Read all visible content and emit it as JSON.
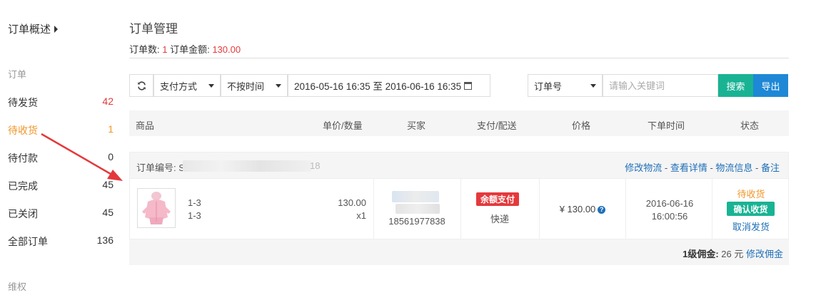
{
  "sidebar": {
    "overview": "订单概述",
    "section_orders": "订单",
    "section_rights": "维权",
    "items": [
      {
        "label": "待发货",
        "count": "42"
      },
      {
        "label": "待收货",
        "count": "1"
      },
      {
        "label": "待付款",
        "count": "0"
      },
      {
        "label": "已完成",
        "count": "45"
      },
      {
        "label": "已关闭",
        "count": "45"
      },
      {
        "label": "全部订单",
        "count": "136"
      }
    ]
  },
  "header": {
    "title": "订单管理",
    "order_count_label": "订单数: ",
    "order_count": "1",
    "order_amount_label": " 订单金额: ",
    "order_amount": "130.00"
  },
  "filters": {
    "payment_method": "支付方式",
    "time_mode": "不按时间",
    "date_range": "2016-05-16 16:35 至 2016-06-16 16:35",
    "search_field": "订单号",
    "keyword_placeholder": "请输入关键词",
    "search_button": "搜索",
    "export_button": "导出"
  },
  "table": {
    "headers": [
      "商品",
      "单价/数量",
      "买家",
      "支付/配送",
      "价格",
      "下单时间",
      "状态"
    ]
  },
  "order": {
    "number_label": "订单编号: SH",
    "number_tail": "18",
    "links": [
      "修改物流",
      "查看详情",
      "物流信息",
      "备注"
    ],
    "link_separator": " - ",
    "sku_line1": "1-3",
    "sku_line2": "1-3",
    "unit_price": "130.00",
    "quantity": "x1",
    "buyer_phone": "18561977838",
    "pay_badge": "余额支付",
    "shipping": "快递",
    "price": "¥ 130.00",
    "help_icon": "?",
    "date": "2016-06-16",
    "time": "16:00:56",
    "status": "待收货",
    "confirm_button": "确认收货",
    "cancel_link": "取消发货",
    "commission_label": "1级佣金:",
    "commission_value": " 26 元 ",
    "commission_link": "修改佣金"
  },
  "colors": {
    "accent_green": "#19b394",
    "accent_blue": "#1e88d6",
    "red": "#e4393c",
    "orange": "#f0962a"
  }
}
